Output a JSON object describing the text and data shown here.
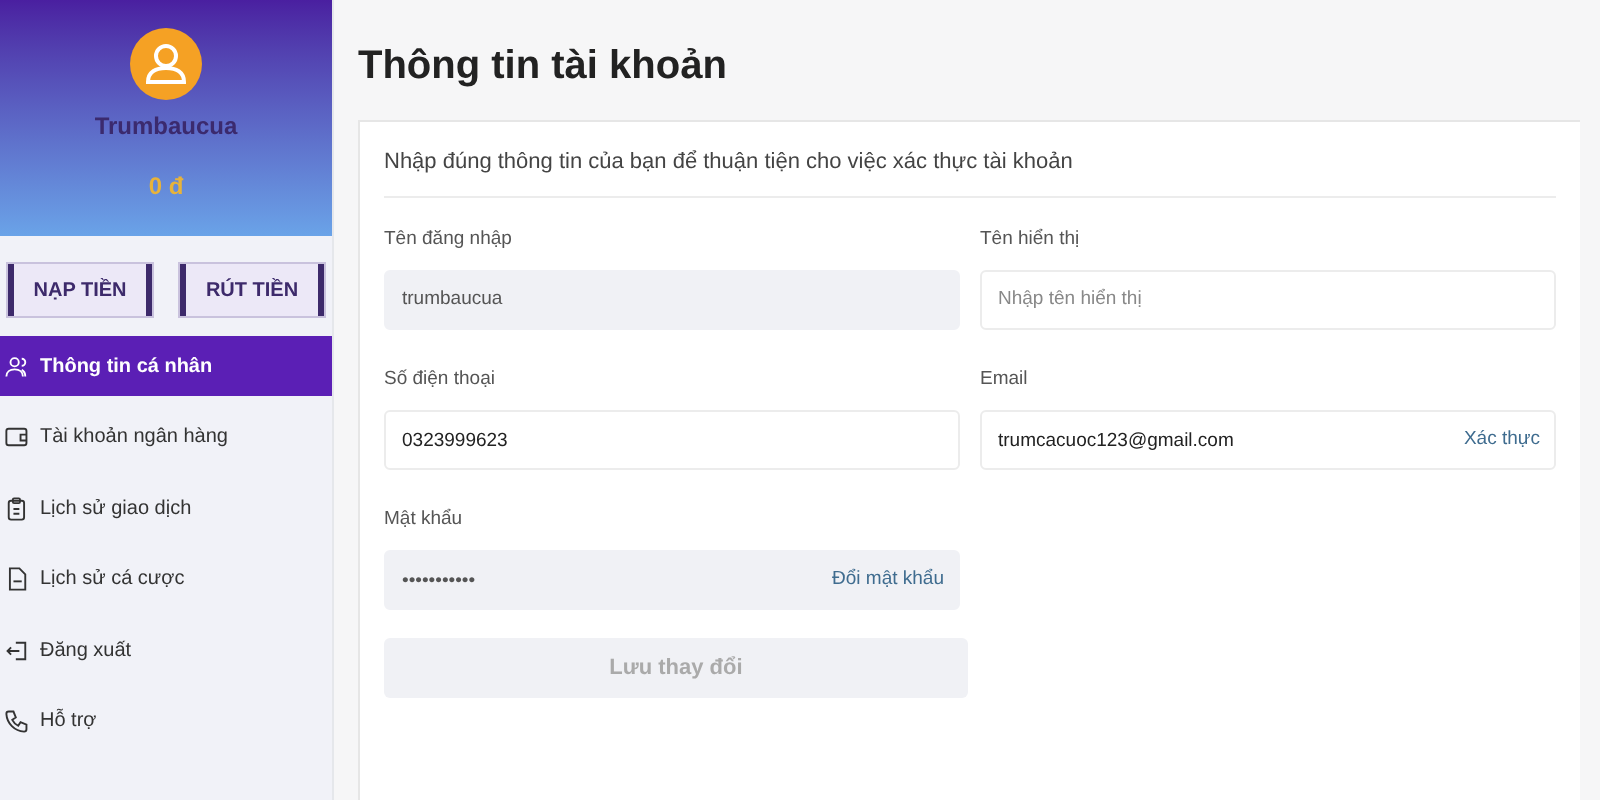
{
  "sidebar": {
    "user": {
      "name": "Trumbaucua",
      "balance": "0 đ"
    },
    "buttons": [
      "NẠP TIỀN",
      "RÚT TIỀN"
    ],
    "items": [
      {
        "label": "Thông tin cá nhân",
        "selected": true
      },
      {
        "label": "Tài khoản ngân hàng",
        "selected": false
      },
      {
        "label": "Lịch sử giao dịch",
        "selected": false
      },
      {
        "label": "Lịch sử cá cược",
        "selected": false
      },
      {
        "label": "Đăng xuất",
        "selected": false
      },
      {
        "label": "Hỗ trợ",
        "selected": false
      }
    ]
  },
  "page": {
    "title": "Thông tin tài khoản",
    "intro": "Nhập đúng thông tin của bạn để thuận tiện cho việc xác thực tài khoản",
    "fields": [
      {
        "label": "Tên đăng nhập",
        "value": "trumbaucua",
        "disabled": true
      },
      {
        "label": "Tên hiển thị",
        "placeholder": "Nhập tên hiển thị",
        "disabled": false
      },
      {
        "label": "Số điện thoại",
        "value": "0323999623",
        "disabled": false
      },
      {
        "label": "Email",
        "value": "trumcacuoc123@gmail.com",
        "action": "Xác thực",
        "disabled": false
      },
      {
        "label": "Mật khẩu",
        "value": "•••••••••••",
        "action": "Đổi mật khẩu",
        "disabled": true
      }
    ],
    "save_button": {
      "label": "Lưu thay đổi",
      "disabled": true
    }
  }
}
